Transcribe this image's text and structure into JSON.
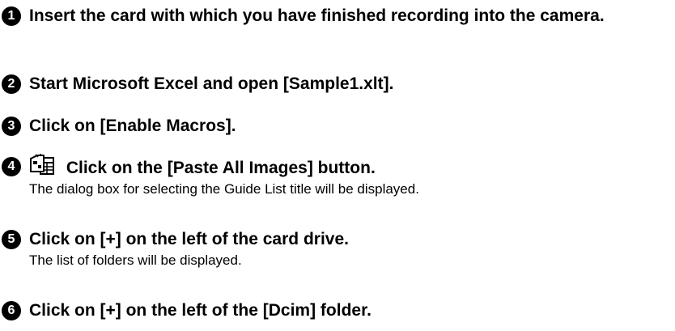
{
  "steps": [
    {
      "number": "1",
      "title": "Insert the card with which you have finished recording into the camera."
    },
    {
      "number": "2",
      "title": "Start Microsoft Excel and open [Sample1.xlt]."
    },
    {
      "number": "3",
      "title": "Click on [Enable Macros]."
    },
    {
      "number": "4",
      "icon": "paste-all-images-icon",
      "title": "Click on the [Paste All Images] button.",
      "detail": "The dialog box for selecting the Guide List title will be displayed."
    },
    {
      "number": "5",
      "title": "Click on [+] on the left of the card drive.",
      "detail": "The list of folders will be displayed."
    },
    {
      "number": "6",
      "title": "Click on [+] on the left of the [Dcim] folder."
    }
  ]
}
